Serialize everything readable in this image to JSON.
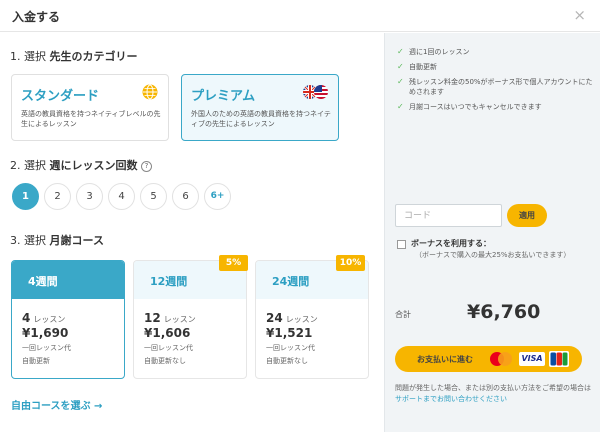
{
  "modal": {
    "title": "入金する",
    "close_symbol": "×"
  },
  "section1": {
    "prefix": "1. 選択 ",
    "label": "先生のカテゴリー"
  },
  "categories": [
    {
      "name": "スタンダード",
      "desc": "英語の教員資格を持つネイティブレベルの先生によるレッスン",
      "icon": "globe-icon"
    },
    {
      "name": "プレミアム",
      "desc": "外国人のための英語の教員資格を持つネイティブの先生によるレッスン",
      "icon": "uk-us-flags-icon"
    }
  ],
  "section2": {
    "prefix": "2. 選択 ",
    "label": "週にレッスン回数",
    "help_symbol": "?"
  },
  "lesson_counts": [
    "1",
    "2",
    "3",
    "4",
    "5",
    "6",
    "6+"
  ],
  "selected_count": "1",
  "section3": {
    "prefix": "3. 選択 ",
    "label": "月謝コース"
  },
  "courses": [
    {
      "name": "4週間",
      "lessons": "4",
      "lesson_unit": "レッスン",
      "price": "¥1,690",
      "price_unit": "一回レッスン代",
      "auto": "自動更新",
      "discount": ""
    },
    {
      "name": "12週間",
      "lessons": "12",
      "lesson_unit": "レッスン",
      "price": "¥1,606",
      "price_unit": "一回レッスン代",
      "auto": "自動更新なし",
      "discount": "5%"
    },
    {
      "name": "24週間",
      "lessons": "24",
      "lesson_unit": "レッスン",
      "price": "¥1,521",
      "price_unit": "一回レッスン代",
      "auto": "自動更新なし",
      "discount": "10%"
    }
  ],
  "free_course_link": "自由コースを選ぶ →",
  "benefits": [
    "週に1回のレッスン",
    "自動更新",
    "残レッスン料金の50%がボーナス形で個人アカウントにためされます",
    "月謝コースはいつでもキャンセルできます"
  ],
  "coupon": {
    "placeholder": "コード",
    "apply_label": "適用"
  },
  "bonus": {
    "label": "ボーナスを利用する：",
    "note": "（ボーナスで購入の最大25%お支払いできます）"
  },
  "total": {
    "label": "合計",
    "value": "¥6,760"
  },
  "pay": {
    "label": "お支払いに進む",
    "visa": "VISA",
    "mastercard": "MasterCard",
    "jcb": "JCB"
  },
  "help": {
    "text": "問題が発生した場合、または別の支払い方法をご希望の場合は ",
    "link": "サポートまでお問い合わせください"
  },
  "colors": {
    "accent": "#3aa8c8",
    "cta": "#f7b500",
    "check": "#5cb85c"
  }
}
